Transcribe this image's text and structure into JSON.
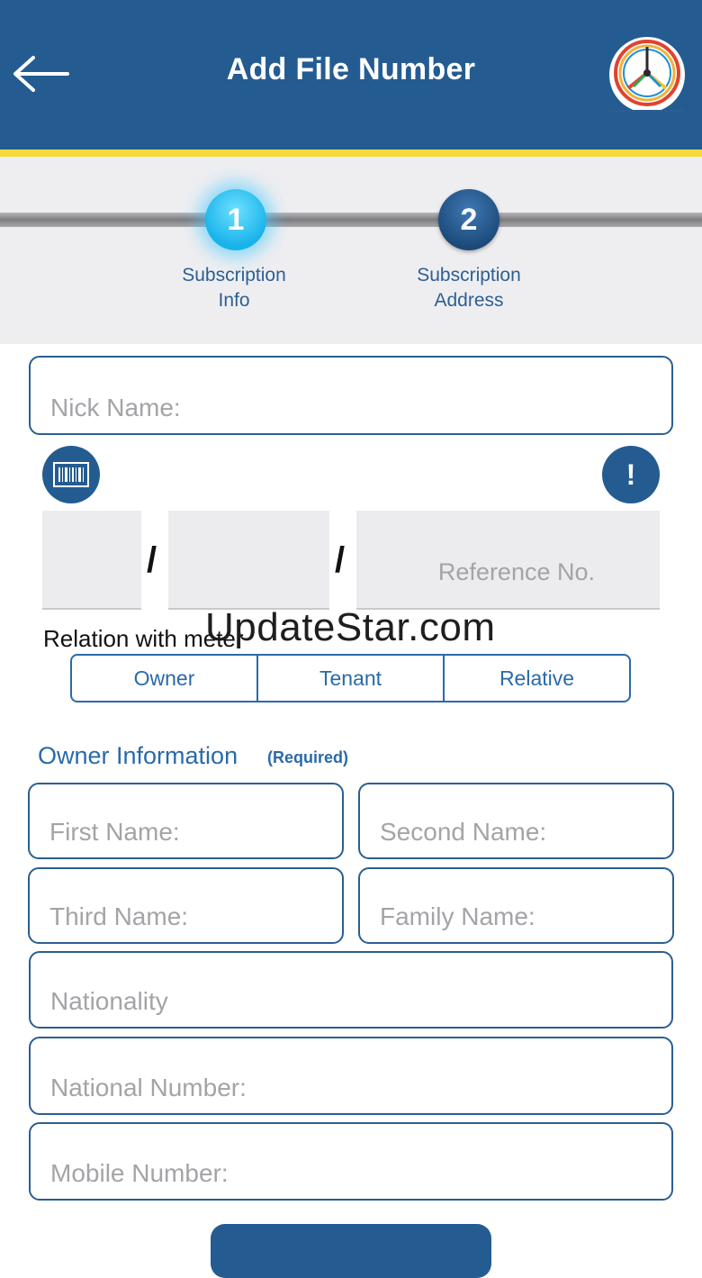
{
  "header": {
    "title": "Add File Number",
    "back_icon": "arrow-left-icon",
    "logo_icon": "utility-logo-icon"
  },
  "stepper": {
    "steps": [
      {
        "number": "1",
        "label_line1": "Subscription",
        "label_line2": "Info",
        "state": "active"
      },
      {
        "number": "2",
        "label_line1": "Subscription",
        "label_line2": "Address",
        "state": "pending"
      }
    ]
  },
  "form": {
    "nick_name_placeholder": "Nick Name:",
    "barcode_icon": "barcode-icon",
    "info_icon": "exclamation-icon",
    "info_symbol": "!",
    "file_number": {
      "separator": "/",
      "reference_placeholder": "Reference No."
    },
    "relation": {
      "label": "Relation with meter",
      "options": [
        "Owner",
        "Tenant",
        "Relative"
      ]
    },
    "owner_section": {
      "title": "Owner Information",
      "required": "(Required)",
      "first_name": "First Name:",
      "second_name": "Second Name:",
      "third_name": "Third Name:",
      "family_name": "Family Name:",
      "nationality": "Nationality",
      "national_number": "National Number:",
      "mobile_number": "Mobile Number:"
    }
  },
  "watermark": "UpdateStar.com",
  "colors": {
    "header": "#245c92",
    "stripe": "#f3d93a",
    "accent": "#2a6aaa",
    "active_step": "#18b3ea"
  }
}
